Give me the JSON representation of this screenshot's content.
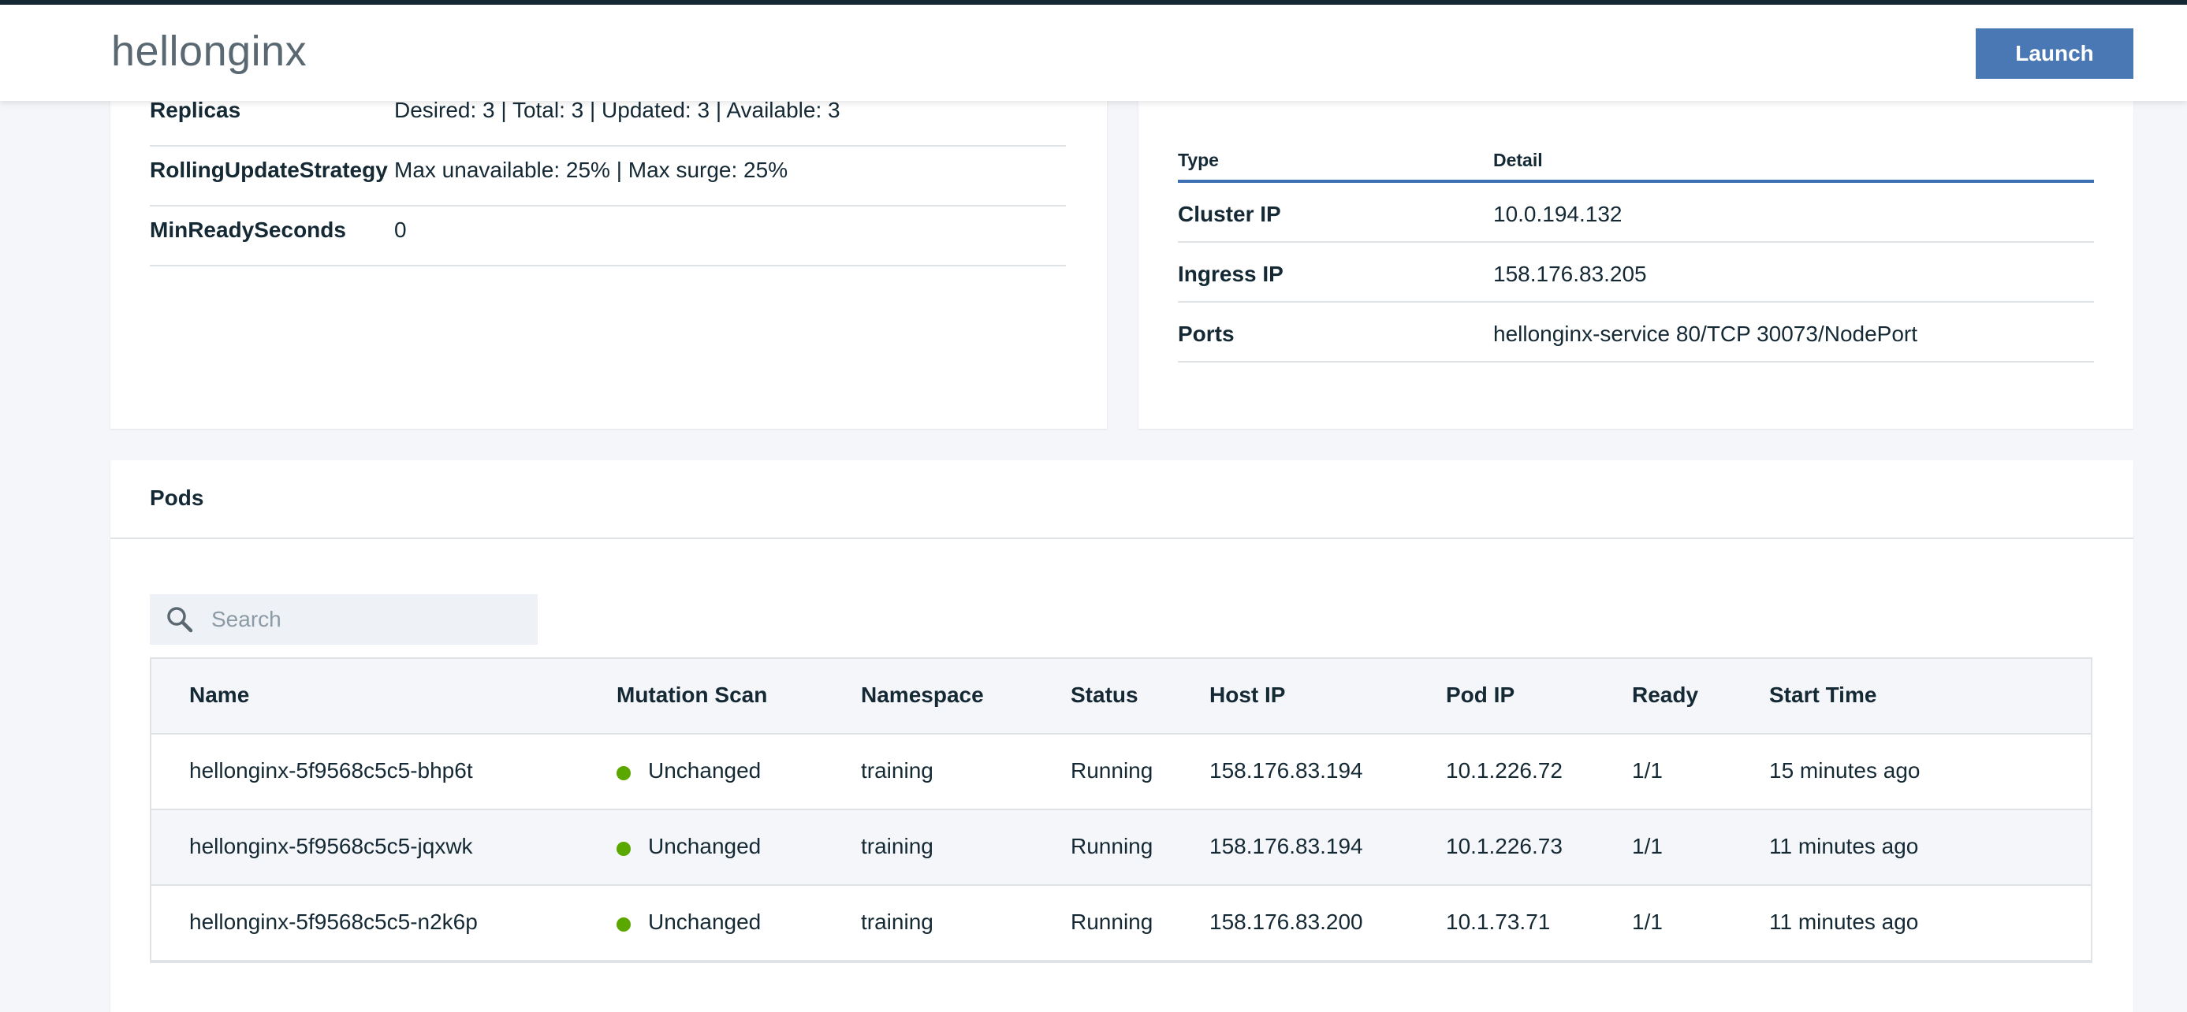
{
  "header": {
    "title": "hellonginx",
    "launch_label": "Launch"
  },
  "deployment": {
    "rows": [
      {
        "key": "Replicas",
        "value": "Desired: 3 | Total: 3 | Updated: 3 | Available: 3"
      },
      {
        "key": "RollingUpdateStrategy",
        "value": "Max unavailable: 25% | Max surge: 25%"
      },
      {
        "key": "MinReadySeconds",
        "value": "0"
      }
    ]
  },
  "service": {
    "headers": {
      "type": "Type",
      "detail": "Detail"
    },
    "rows": [
      {
        "type": "Cluster IP",
        "detail": "10.0.194.132"
      },
      {
        "type": "Ingress IP",
        "detail": "158.176.83.205"
      },
      {
        "type": "Ports",
        "detail": "hellonginx-service 80/TCP 30073/NodePort"
      }
    ]
  },
  "pods": {
    "title": "Pods",
    "search": {
      "placeholder": "Search",
      "value": ""
    },
    "columns": [
      "Name",
      "Mutation Scan",
      "Namespace",
      "Status",
      "Host IP",
      "Pod IP",
      "Ready",
      "Start Time"
    ],
    "rows": [
      {
        "name": "hellonginx-5f9568c5c5-bhp6t",
        "mutation": "Unchanged",
        "namespace": "training",
        "status": "Running",
        "host_ip": "158.176.83.194",
        "pod_ip": "10.1.226.72",
        "ready": "1/1",
        "start": "15 minutes ago"
      },
      {
        "name": "hellonginx-5f9568c5c5-jqxwk",
        "mutation": "Unchanged",
        "namespace": "training",
        "status": "Running",
        "host_ip": "158.176.83.194",
        "pod_ip": "10.1.226.73",
        "ready": "1/1",
        "start": "11 minutes ago"
      },
      {
        "name": "hellonginx-5f9568c5c5-n2k6p",
        "mutation": "Unchanged",
        "namespace": "training",
        "status": "Running",
        "host_ip": "158.176.83.200",
        "pod_ip": "10.1.73.71",
        "ready": "1/1",
        "start": "11 minutes ago"
      }
    ]
  },
  "colors": {
    "accent": "#4a78b5",
    "ok_dot": "#5aa700",
    "text": "#152935"
  },
  "icons": {
    "search": "search-icon",
    "status_dot": "status-dot-icon"
  }
}
